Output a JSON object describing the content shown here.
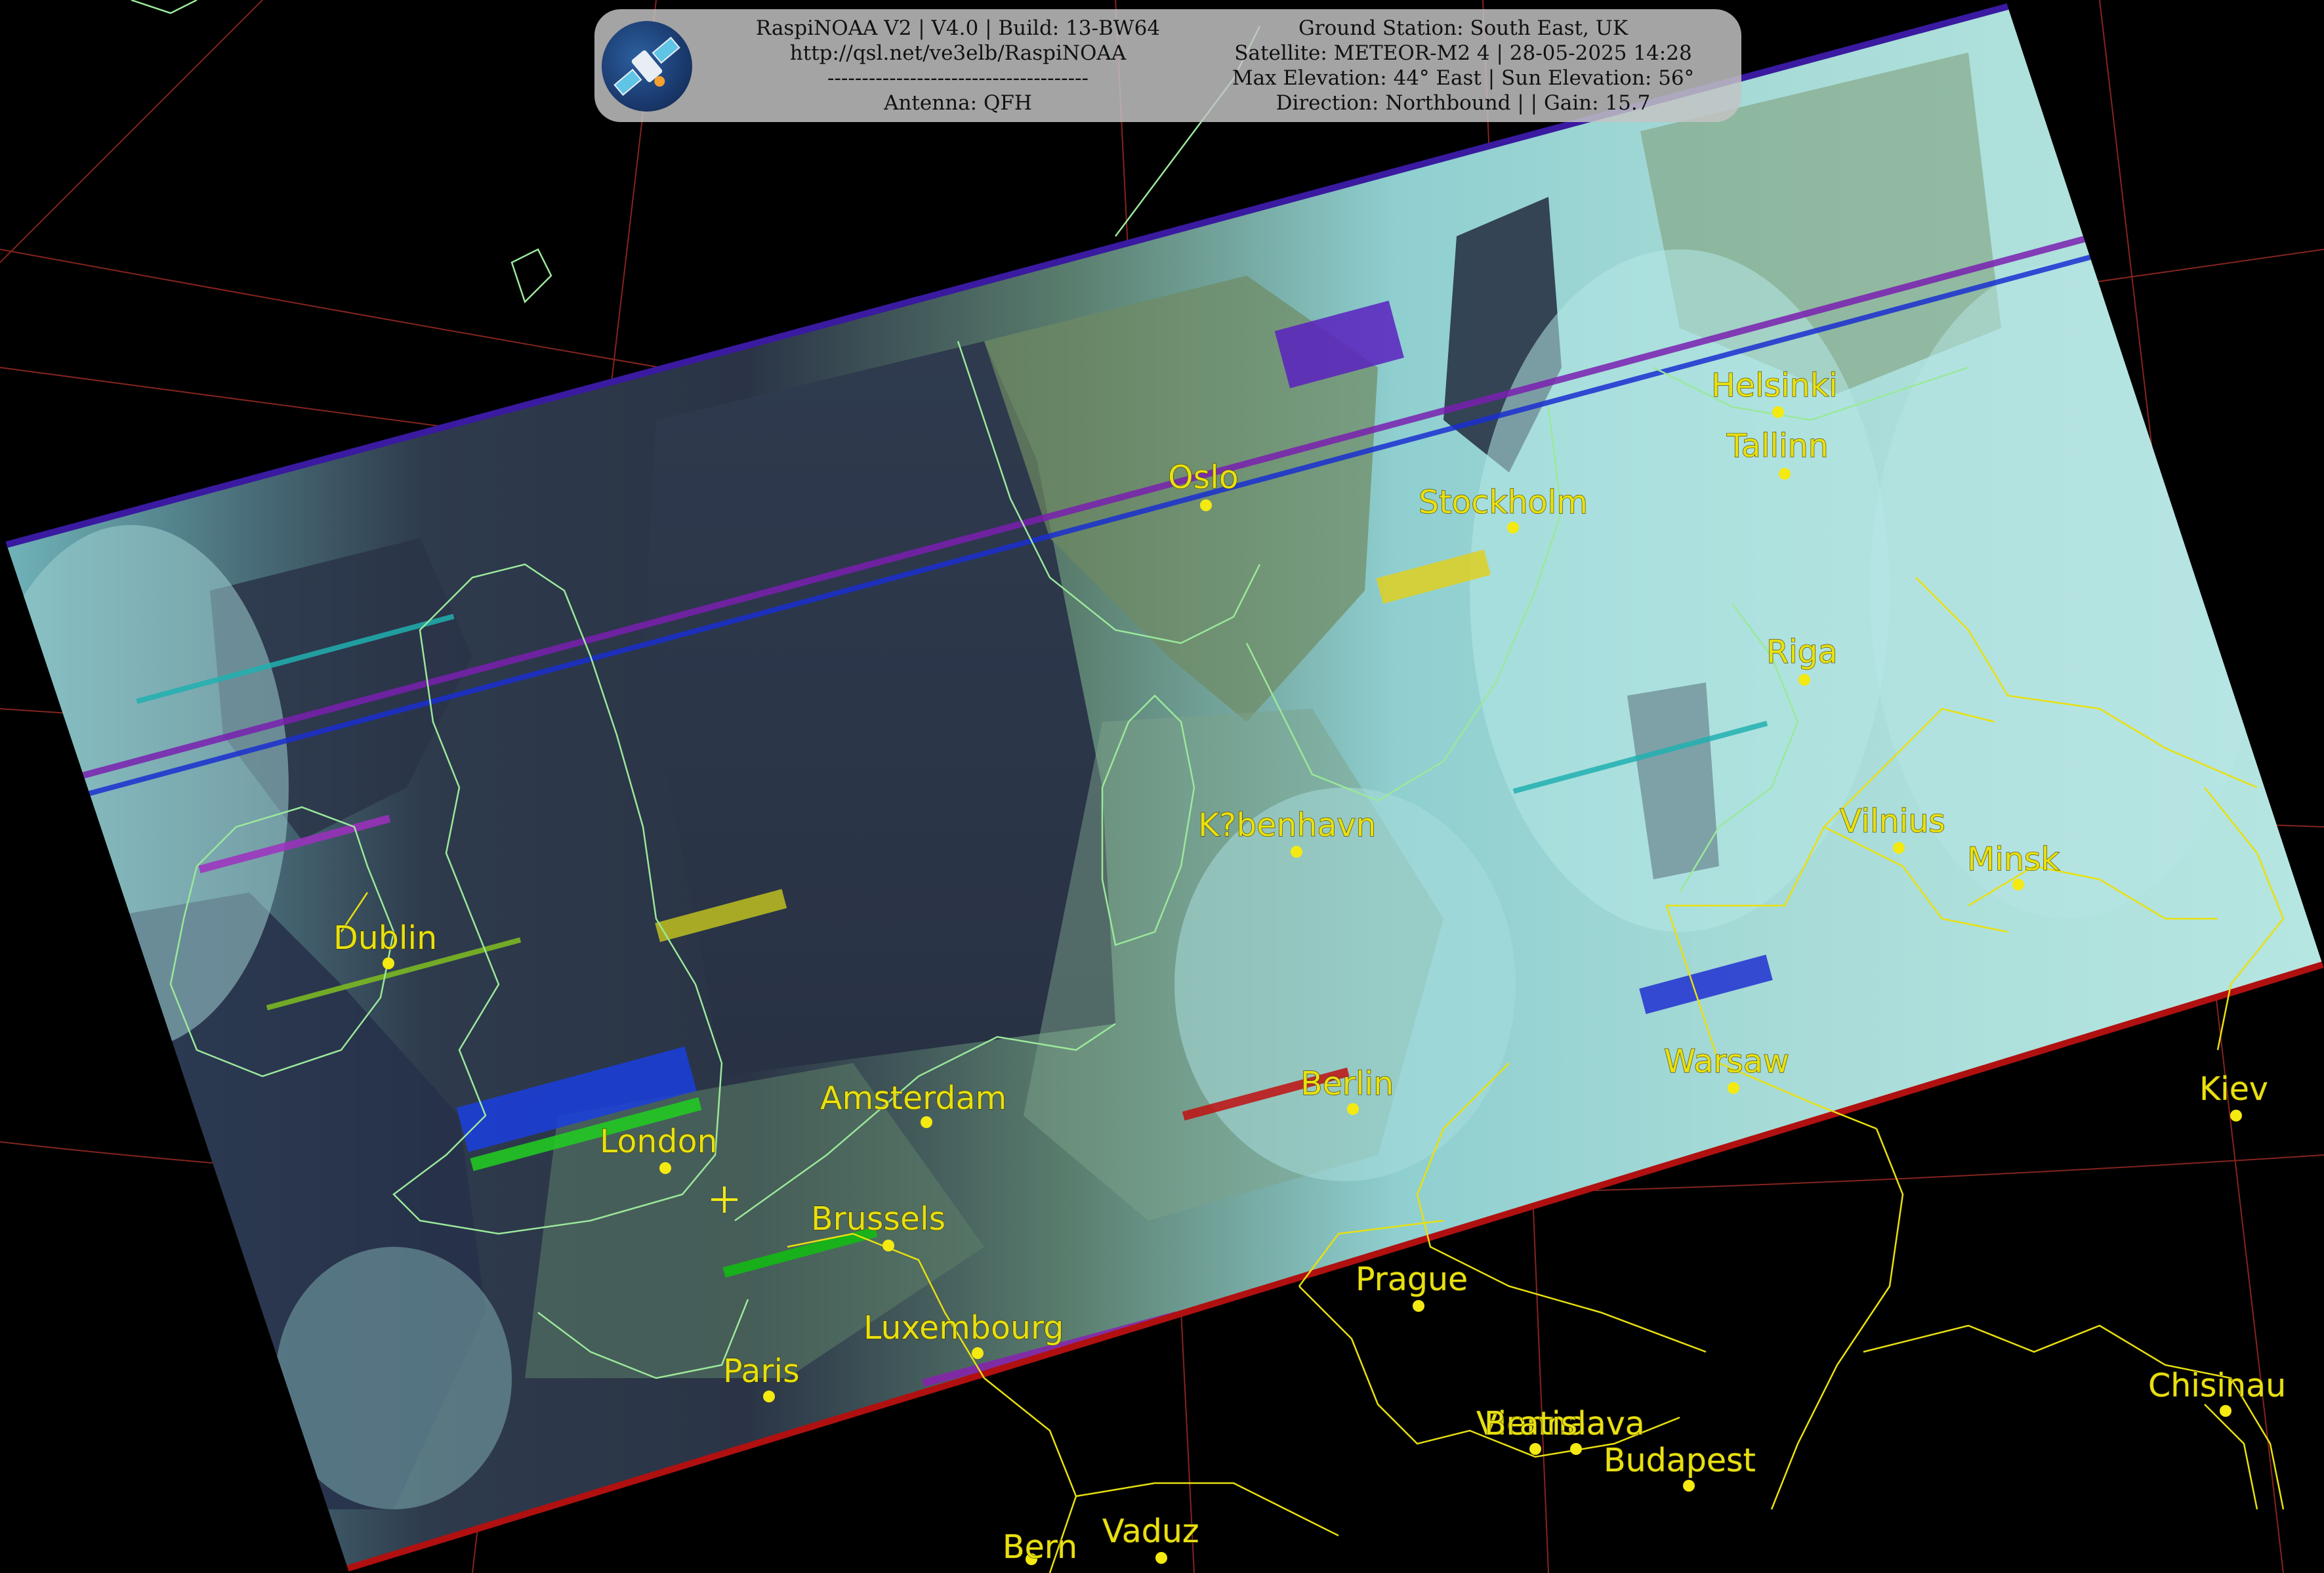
{
  "header": {
    "left": {
      "line1": "RaspiNOAA V2 | V4.0 | Build: 13-BW64",
      "line2": "http://qsl.net/ve3elb/RaspiNOAA",
      "line3": "--------------------------------------",
      "line4": "Antenna: QFH"
    },
    "right": {
      "line1": "Ground Station: South East, UK",
      "line2": "Satellite: METEOR-M2 4 | 28-05-2025 14:28",
      "line3": "Max Elevation: 44° East | Sun Elevation: 56°",
      "line4": "Direction: Northbound | | Gain: 15.7"
    },
    "logo_icon": "satellite-icon"
  },
  "colors": {
    "city_label": "#e8e010",
    "country_border": "#e8e010",
    "coastline": "#9be89b",
    "graticule": "#b0302a",
    "panel_background": "#c4c4c4",
    "background": "#000000"
  },
  "cities": [
    {
      "name": "Helsinki"
    },
    {
      "name": "Tallinn"
    },
    {
      "name": "Oslo"
    },
    {
      "name": "Stockholm"
    },
    {
      "name": "Riga"
    },
    {
      "name": "K?benhavn"
    },
    {
      "name": "Vilnius"
    },
    {
      "name": "Minsk"
    },
    {
      "name": "Dublin"
    },
    {
      "name": "Warsaw"
    },
    {
      "name": "Kiev"
    },
    {
      "name": "Amsterdam"
    },
    {
      "name": "Berlin"
    },
    {
      "name": "London"
    },
    {
      "name": "Brussels"
    },
    {
      "name": "Prague"
    },
    {
      "name": "Luxembourg"
    },
    {
      "name": "Paris"
    },
    {
      "name": "Chisinau"
    },
    {
      "name": "Vienna"
    },
    {
      "name": "Bratislava"
    },
    {
      "name": "Budapest"
    },
    {
      "name": "Bern"
    },
    {
      "name": "Vaduz"
    }
  ],
  "ground_station_marker": "cross-marker-icon"
}
